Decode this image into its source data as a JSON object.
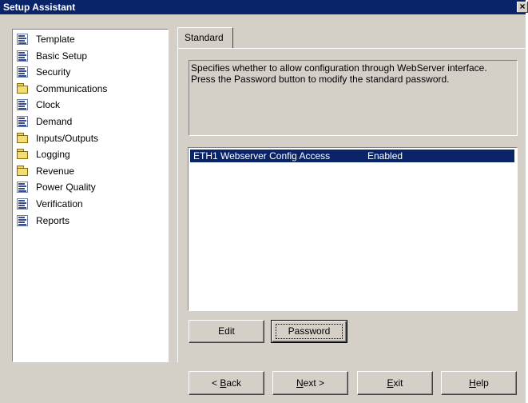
{
  "window": {
    "title": "Setup Assistant",
    "close_glyph": "×"
  },
  "tree": {
    "items": [
      {
        "label": "Template",
        "icon": "document-icon"
      },
      {
        "label": "Basic Setup",
        "icon": "document-icon"
      },
      {
        "label": "Security",
        "icon": "document-icon"
      },
      {
        "label": "Communications",
        "icon": "folder-icon"
      },
      {
        "label": "Clock",
        "icon": "document-icon"
      },
      {
        "label": "Demand",
        "icon": "document-icon"
      },
      {
        "label": "Inputs/Outputs",
        "icon": "folder-icon"
      },
      {
        "label": "Logging",
        "icon": "folder-icon"
      },
      {
        "label": "Revenue",
        "icon": "folder-icon"
      },
      {
        "label": "Power Quality",
        "icon": "document-icon"
      },
      {
        "label": "Verification",
        "icon": "document-icon"
      },
      {
        "label": "Reports",
        "icon": "document-icon"
      }
    ]
  },
  "tabs": {
    "standard": "Standard"
  },
  "description": "Specifies whether to allow configuration through WebServer interface.  Press the Password button to modify the standard password.",
  "settings": {
    "rows": [
      {
        "name": "ETH1 Webserver Config Access",
        "value": "Enabled"
      }
    ]
  },
  "buttons": {
    "edit": "Edit",
    "password": "Password",
    "back_prefix": "< ",
    "back_key": "B",
    "back_rest": "ack",
    "next_key": "N",
    "next_rest": "ext >",
    "exit_key": "E",
    "exit_rest": "xit",
    "help_key": "H",
    "help_rest": "elp"
  }
}
